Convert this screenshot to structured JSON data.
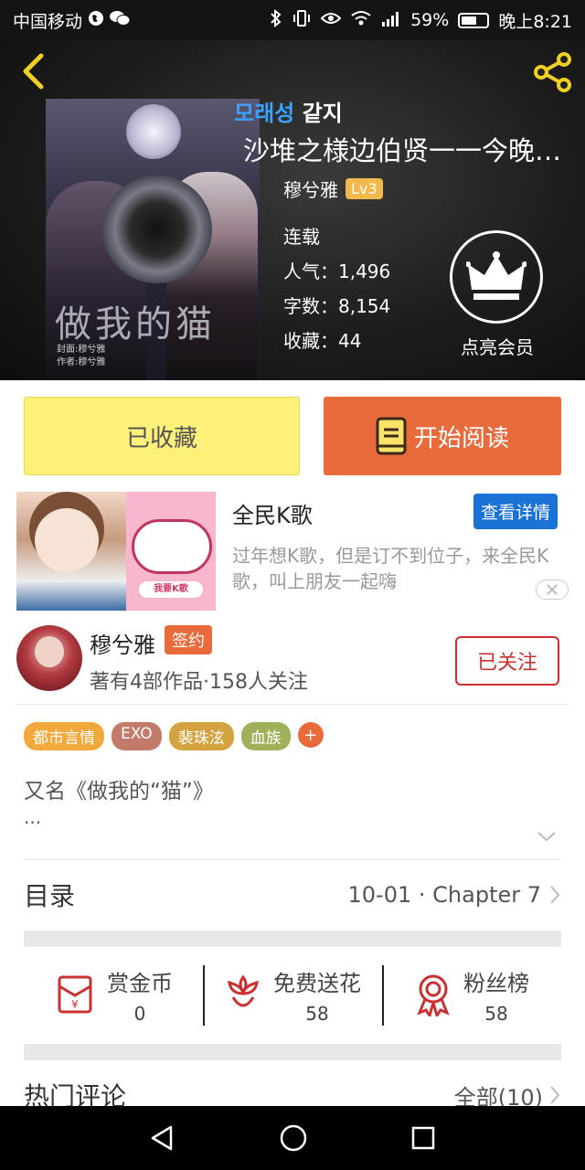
{
  "status_bar": {
    "carrier": "中国移动",
    "battery": "59%",
    "time": "晚上8:21"
  },
  "header": {
    "korean_title_blue": "모래성",
    "korean_title_rest": " 같지",
    "book_title": "沙堆之様边伯贤一一今晚你是我...",
    "author": "穆兮雅",
    "level": "Lv3",
    "status": "连载",
    "stats": [
      {
        "label": "人气：",
        "value": "1,496"
      },
      {
        "label": "字数：",
        "value": "8,154"
      },
      {
        "label": "收藏：",
        "value": "44"
      }
    ],
    "vip_label": "点亮会员",
    "cover_title": "做我的猫",
    "cover_credit_1": "封面:穆兮雅",
    "cover_credit_2": "作者:穆兮雅"
  },
  "actions": {
    "collected_label": "已收藏",
    "read_label": "开始阅读"
  },
  "ad": {
    "title": "全民K歌",
    "detail_label": "查看详情",
    "description": "过年想K歌，但是订不到位子，来全民K歌，叫上朋友一起嗨",
    "image_button": "我要K歌"
  },
  "author_section": {
    "name": "穆兮雅",
    "badge": "签约",
    "info": "著有4部作品·158人关注",
    "follow_label": "已关注"
  },
  "tags": [
    {
      "label": "都市言情",
      "color": "#f2a93b"
    },
    {
      "label": "EXO",
      "color": "#c27a6a"
    },
    {
      "label": "裴珠泫",
      "color": "#d4a23e"
    },
    {
      "label": "血族",
      "color": "#9fb05a"
    }
  ],
  "tag_add": "+",
  "synopsis": {
    "alias": "又名《做我的“猫”》",
    "ellipsis": "..."
  },
  "catalog": {
    "title": "目录",
    "latest": "10-01 · Chapter  7"
  },
  "rewards": [
    {
      "icon": "red-envelope-icon",
      "label": "赏金币",
      "value": "0"
    },
    {
      "icon": "flower-icon",
      "label": "免费送花",
      "value": "58"
    },
    {
      "icon": "medal-icon",
      "label": "粉丝榜",
      "value": "58"
    }
  ],
  "hot_comments": {
    "title": "热门评论",
    "all_label": "全部(10)"
  },
  "colors": {
    "accent_orange": "#e96a3a",
    "collected_yellow": "#fef17a",
    "follow_red": "#c93030",
    "ad_blue": "#1b72d6",
    "level_gold": "#f2b84b"
  }
}
